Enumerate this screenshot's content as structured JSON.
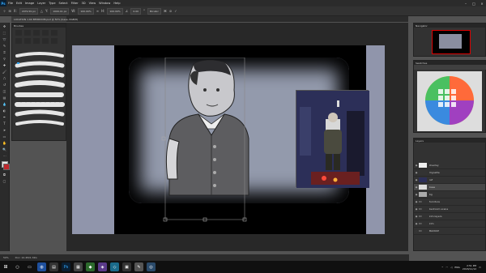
{
  "app": {
    "logo": "Ps"
  },
  "menu": [
    "File",
    "Edit",
    "Image",
    "Layer",
    "Type",
    "Select",
    "Filter",
    "3D",
    "View",
    "Window",
    "Help"
  ],
  "options": {
    "x_value": "2079.59 px",
    "y_value": "1009.41 px",
    "w_value": "100.00%",
    "h_value": "100.00%",
    "angle_value": "0.00",
    "interp": "Bicubic"
  },
  "doc_tab": "LOCATION 1.60 BEDROOM.psd @ 50% (base, RGB/8)",
  "status": {
    "zoom": "50%",
    "doc": "Doc: 10.4M/1.32G"
  },
  "panels": {
    "brushes": "Brushes",
    "navigator": "Navigator",
    "swatches": "Swatches",
    "layers": "Layers"
  },
  "layers": [
    {
      "name": "Overlay",
      "type": "layer",
      "visible": true,
      "selected": false
    },
    {
      "name": "Vignette",
      "type": "layer",
      "visible": true,
      "selected": false
    },
    {
      "name": "ref",
      "type": "layer",
      "visible": true,
      "selected": false
    },
    {
      "name": "base",
      "type": "layer",
      "visible": true,
      "selected": true
    },
    {
      "name": "bg",
      "type": "layer",
      "visible": true,
      "selected": false
    },
    {
      "name": "furniture",
      "type": "group",
      "visible": true,
      "selected": false
    },
    {
      "name": "bedroom scene",
      "type": "group",
      "visible": true,
      "selected": false
    },
    {
      "name": "kim layers",
      "type": "group",
      "visible": true,
      "selected": false
    },
    {
      "name": "kim",
      "type": "group",
      "visible": true,
      "selected": false
    },
    {
      "name": "BACKUP",
      "type": "group",
      "visible": false,
      "selected": false
    }
  ],
  "taskbar": {
    "time": "2:51 PM",
    "date": "2018/11/12",
    "lang": "ENG"
  }
}
